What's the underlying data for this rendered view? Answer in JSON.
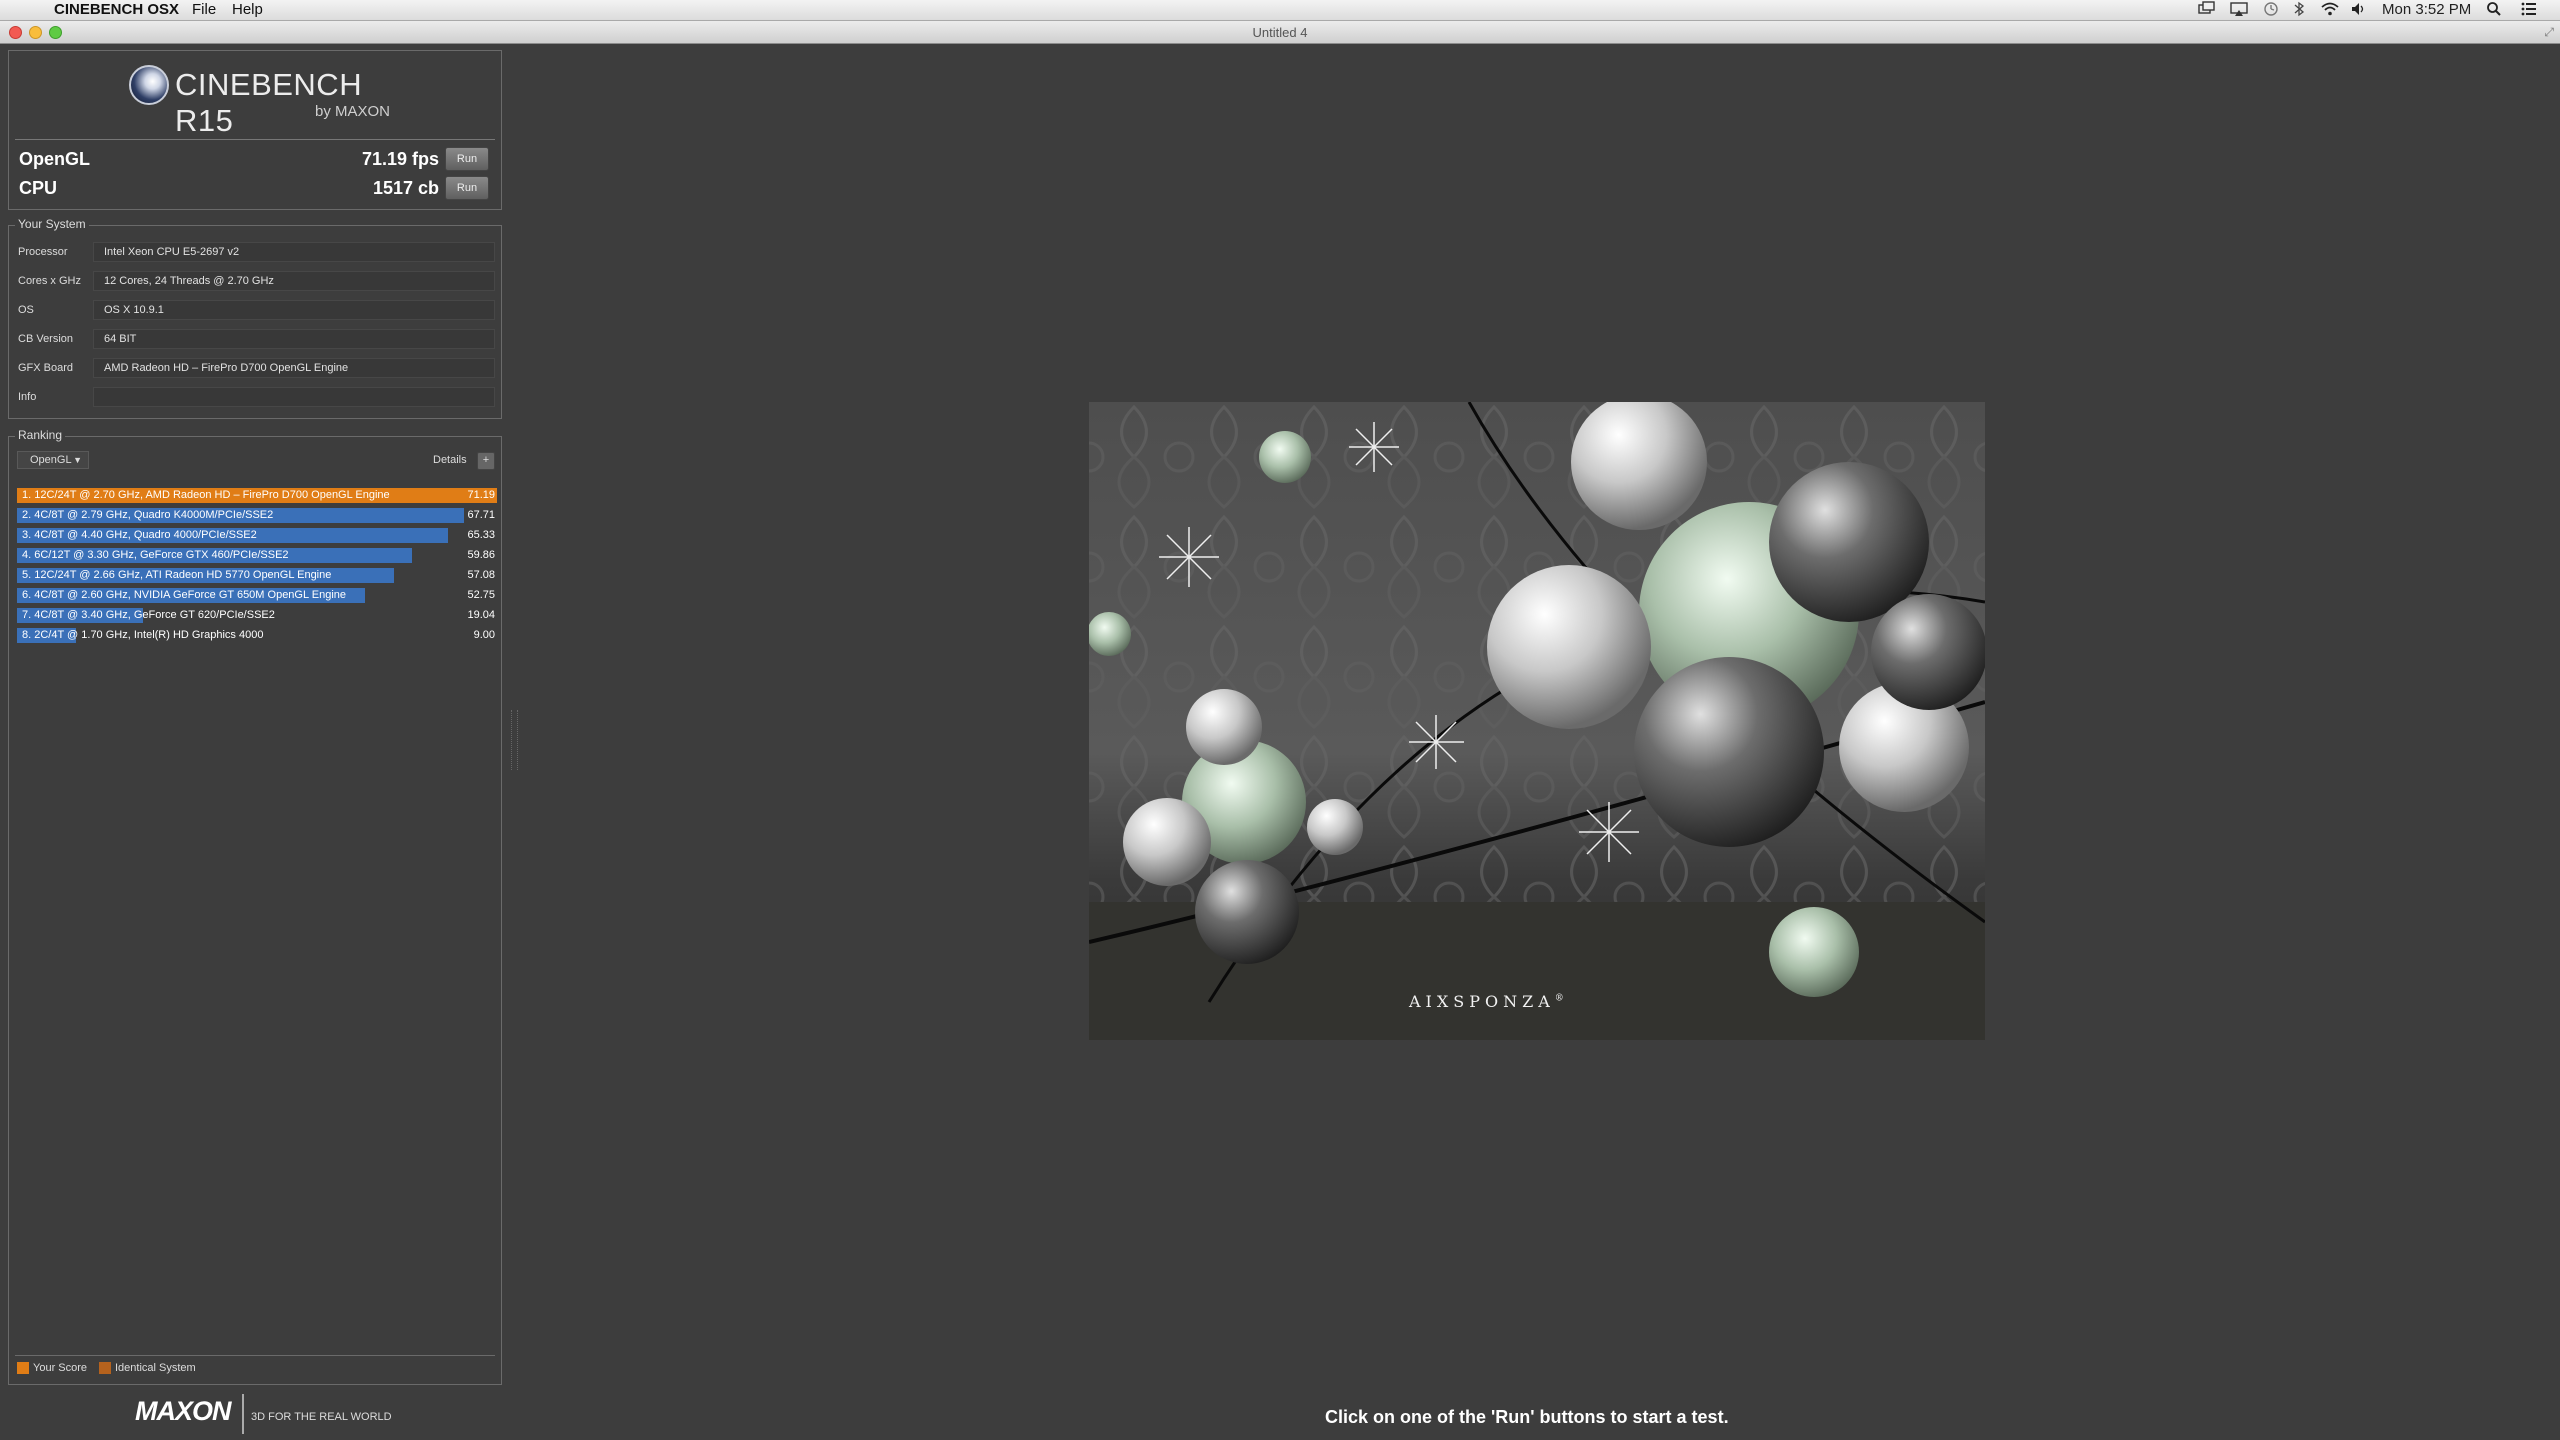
{
  "menubar": {
    "apple_glyph": "",
    "app_name": "CINEBENCH OSX",
    "menus": [
      "File",
      "Help"
    ],
    "clock": "Mon 3:52 PM",
    "status_icons": [
      "display-icon",
      "airplay-icon",
      "time-machine-icon",
      "bluetooth-icon",
      "wifi-icon",
      "volume-icon",
      "spotlight-icon",
      "notification-center-icon"
    ]
  },
  "window": {
    "title": "Untitled 4"
  },
  "logo": {
    "name": "CINEBENCH R15",
    "sub": "by MAXON"
  },
  "scores": {
    "opengl_label": "OpenGL",
    "opengl_value": "71.19 fps",
    "cpu_label": "CPU",
    "cpu_value": "1517 cb",
    "run_label": "Run"
  },
  "system": {
    "legend": "Your System",
    "rows": [
      {
        "label": "Processor",
        "value": "Intel Xeon CPU E5-2697 v2"
      },
      {
        "label": "Cores x GHz",
        "value": "12 Cores, 24 Threads @ 2.70 GHz"
      },
      {
        "label": "OS",
        "value": "OS X 10.9.1"
      },
      {
        "label": "CB Version",
        "value": "64 BIT"
      },
      {
        "label": "GFX Board",
        "value": "AMD Radeon HD – FirePro D700 OpenGL Engine"
      },
      {
        "label": "Info",
        "value": ""
      }
    ]
  },
  "ranking": {
    "legend": "Ranking",
    "selected": "OpenGL",
    "details_label": "Details",
    "details_button": "+",
    "max_score": 71.19,
    "rows": [
      {
        "text": "1. 12C/24T @ 2.70 GHz, AMD Radeon HD – FirePro D700 OpenGL Engine",
        "score": "71.19",
        "value": 71.19,
        "highlight": true
      },
      {
        "text": "2. 4C/8T @ 2.79 GHz, Quadro K4000M/PCIe/SSE2",
        "score": "67.71",
        "value": 67.71,
        "highlight": false
      },
      {
        "text": "3. 4C/8T @ 4.40 GHz, Quadro 4000/PCIe/SSE2",
        "score": "65.33",
        "value": 65.33,
        "highlight": false
      },
      {
        "text": "4. 6C/12T @ 3.30 GHz, GeForce GTX 460/PCIe/SSE2",
        "score": "59.86",
        "value": 59.86,
        "highlight": false
      },
      {
        "text": "5. 12C/24T @ 2.66 GHz, ATI Radeon HD 5770 OpenGL Engine",
        "score": "57.08",
        "value": 57.08,
        "highlight": false
      },
      {
        "text": "6. 4C/8T @ 2.60 GHz, NVIDIA GeForce GT 650M OpenGL Engine",
        "score": "52.75",
        "value": 52.75,
        "highlight": false
      },
      {
        "text": "7. 4C/8T @ 3.40 GHz, GeForce GT 620/PCIe/SSE2",
        "score": "19.04",
        "value": 19.04,
        "highlight": false
      },
      {
        "text": "8. 2C/4T @ 1.70 GHz, Intel(R) HD Graphics 4000",
        "score": "9.00",
        "value": 9.0,
        "highlight": false
      }
    ],
    "legend_items": [
      "Your Score",
      "Identical System"
    ]
  },
  "colors": {
    "highlight_bar": "#e07d16",
    "normal_bar": "#3a70b8",
    "your_score": "#e07d16",
    "identical_system": "#b5621d"
  },
  "footer": {
    "brand": "MAXON",
    "tagline": "3D FOR THE REAL WORLD"
  },
  "render": {
    "watermark": "AIXSPONZA",
    "watermark_mark": "®"
  },
  "status": "Click on one of the 'Run' buttons to start a test."
}
